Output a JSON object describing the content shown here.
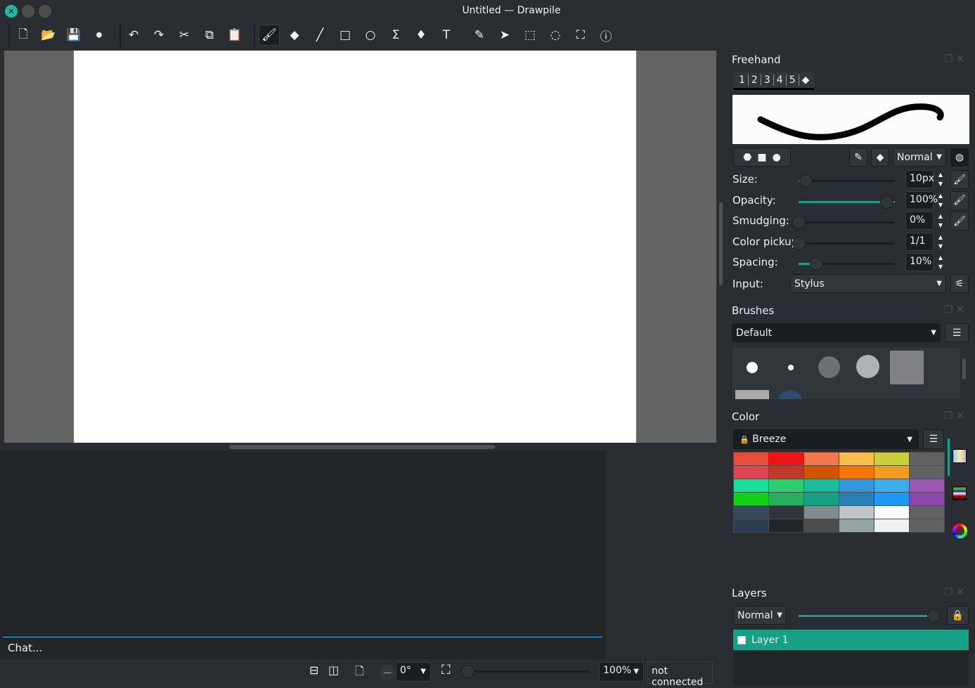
{
  "window": {
    "title": "Untitled — Drawpile"
  },
  "toolbar": {
    "items": [
      {
        "name": "new-icon",
        "glyph": "🗋"
      },
      {
        "name": "open-icon",
        "glyph": "📂"
      },
      {
        "name": "save-icon",
        "glyph": "💾"
      },
      {
        "name": "record-icon",
        "glyph": "⏺"
      },
      {
        "name": "undo-icon",
        "glyph": "↶"
      },
      {
        "name": "redo-icon",
        "glyph": "↷"
      },
      {
        "name": "cut-icon",
        "glyph": "✂"
      },
      {
        "name": "copy-icon",
        "glyph": "⧉"
      },
      {
        "name": "paste-icon",
        "glyph": "📋"
      },
      {
        "name": "brush-tool-icon",
        "glyph": "🖌"
      },
      {
        "name": "eraser-tool-icon",
        "glyph": "◆"
      },
      {
        "name": "line-tool-icon",
        "glyph": "╱"
      },
      {
        "name": "rectangle-tool-icon",
        "glyph": "□"
      },
      {
        "name": "ellipse-tool-icon",
        "glyph": "○"
      },
      {
        "name": "bezier-tool-icon",
        "glyph": "Σ"
      },
      {
        "name": "fill-tool-icon",
        "glyph": "♦"
      },
      {
        "name": "text-tool-icon",
        "glyph": "T"
      },
      {
        "name": "color-picker-tool-icon",
        "glyph": "✎"
      },
      {
        "name": "laser-pointer-icon",
        "glyph": "➤"
      },
      {
        "name": "rect-select-icon",
        "glyph": "⬚"
      },
      {
        "name": "lasso-select-icon",
        "glyph": "◌"
      },
      {
        "name": "zoom-tool-icon",
        "glyph": "⛶"
      },
      {
        "name": "inspector-tool-icon",
        "glyph": "ⓘ"
      }
    ]
  },
  "chat": {
    "placeholder": "Chat..."
  },
  "status": {
    "rotation": "0°",
    "zoom": "100%",
    "connection": "not connected"
  },
  "freehand": {
    "title": "Freehand",
    "slots": [
      "1",
      "2",
      "3",
      "4",
      "5"
    ],
    "blend_mode": "Normal",
    "rows": [
      {
        "label": "Size:",
        "value": "10px",
        "level": 0.08
      },
      {
        "label": "Opacity:",
        "value": "100%",
        "level": 1.0
      },
      {
        "label": "Smudging:",
        "value": "0%",
        "level": 0.0
      },
      {
        "label": "Color pickup:",
        "value": "1/1",
        "level": 0.0
      },
      {
        "label": "Spacing:",
        "value": "10%",
        "level": 0.2
      }
    ],
    "input_label": "Input:",
    "input_value": "Stylus"
  },
  "brushes": {
    "title": "Brushes",
    "preset": "Default"
  },
  "color": {
    "title": "Color",
    "palette_name": "Breeze",
    "swatches": [
      "#e74c3c",
      "#ed1515",
      "#f47750",
      "#fdbc4b",
      "#c9ce3b",
      "#616161",
      "#da4453",
      "#c0392b",
      "#d35400",
      "#f67400",
      "#f39c1f",
      "#616161",
      "#1cdc9a",
      "#2ecc71",
      "#1abc9c",
      "#3498db",
      "#3daee9",
      "#9b59b6",
      "#11d116",
      "#27ae60",
      "#16a085",
      "#2980b9",
      "#1d99f3",
      "#8e44ad",
      "#34495e",
      "#31363b",
      "#7f8c8d",
      "#bdc3c7",
      "#fcfcfc",
      "#616161",
      "#2c3e50",
      "#232629",
      "#4d4d4d",
      "#95a5a6",
      "#eff0f1",
      "#616161"
    ]
  },
  "layers": {
    "title": "Layers",
    "blend_mode": "Normal",
    "opacity": 1.0,
    "items": [
      {
        "name": "Layer 1",
        "selected": true
      }
    ]
  },
  "colors": {
    "accent": "#16a085",
    "selection": "#3daee9",
    "close": "#1abc9c"
  }
}
